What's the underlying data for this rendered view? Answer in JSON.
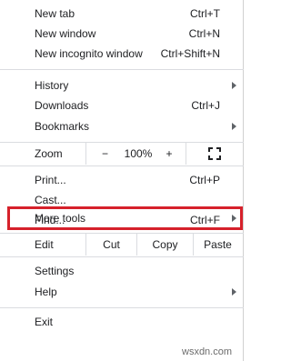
{
  "menu": {
    "new_tab": {
      "label": "New tab",
      "shortcut": "Ctrl+T"
    },
    "new_window": {
      "label": "New window",
      "shortcut": "Ctrl+N"
    },
    "new_incognito": {
      "label": "New incognito window",
      "shortcut": "Ctrl+Shift+N"
    },
    "history": {
      "label": "History"
    },
    "downloads": {
      "label": "Downloads",
      "shortcut": "Ctrl+J"
    },
    "bookmarks": {
      "label": "Bookmarks"
    },
    "zoom": {
      "label": "Zoom",
      "minus": "−",
      "level": "100%",
      "plus": "+",
      "fullscreen_icon": "fullscreen-icon"
    },
    "print": {
      "label": "Print...",
      "shortcut": "Ctrl+P"
    },
    "cast": {
      "label": "Cast..."
    },
    "find": {
      "label": "Find...",
      "shortcut": "Ctrl+F"
    },
    "more_tools": {
      "label": "More tools"
    },
    "edit": {
      "label": "Edit",
      "cut": "Cut",
      "copy": "Copy",
      "paste": "Paste"
    },
    "settings": {
      "label": "Settings"
    },
    "help": {
      "label": "Help"
    },
    "exit": {
      "label": "Exit"
    }
  },
  "colors": {
    "highlight": "#d6212b",
    "separator": "#dadce0"
  },
  "watermark": "wsxdn.com"
}
